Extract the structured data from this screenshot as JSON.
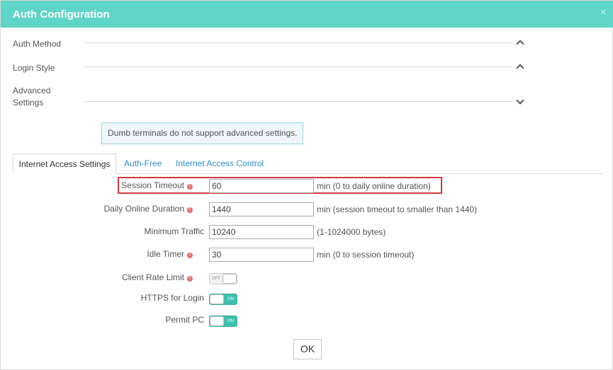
{
  "dialog": {
    "title": "Auth Configuration",
    "close_glyph": "×"
  },
  "sections": [
    {
      "label": "Auth Method",
      "state": "expanded"
    },
    {
      "label": "Login Style",
      "state": "expanded"
    },
    {
      "label_line1": "Advanced",
      "label_line2": "Settings",
      "state": "collapsed"
    }
  ],
  "notice": "Dumb terminals do not support advanced settings.",
  "tabs": [
    {
      "label": "Internet Access Settings",
      "active": true
    },
    {
      "label": "Auth-Free",
      "active": false
    },
    {
      "label": "Internet Access Control",
      "active": false
    }
  ],
  "fields": {
    "session_timeout": {
      "label": "Session Timeout",
      "value": "60",
      "hint": "min (0 to daily online duration)"
    },
    "daily_online_duration": {
      "label": "Daily Online Duration",
      "value": "1440",
      "hint": "min (session timeout to smaller than 1440)"
    },
    "minimum_traffic": {
      "label": "Minimum Traffic",
      "value": "10240",
      "hint": "(1-1024000 bytes)"
    },
    "idle_timer": {
      "label": "Idle Timer",
      "value": "30",
      "hint": "min (0 to session timeout)"
    }
  },
  "toggles": {
    "client_rate_limit": {
      "label": "Client Rate Limit",
      "state_text": "OFF",
      "on": false
    },
    "https_for_login": {
      "label": "HTTPS for Login",
      "state_text": "ON",
      "on": true
    },
    "permit_pc": {
      "label": "Permit PC",
      "state_text": "ON",
      "on": true
    }
  },
  "info_glyph": "!",
  "footer": {
    "ok_label": "OK"
  },
  "colors": {
    "titlebar": "#5fd5c7",
    "link": "#2e8fc7",
    "toggle_on": "#3fc0ad",
    "highlight": "#d0383d",
    "info": "#e46c6c"
  }
}
